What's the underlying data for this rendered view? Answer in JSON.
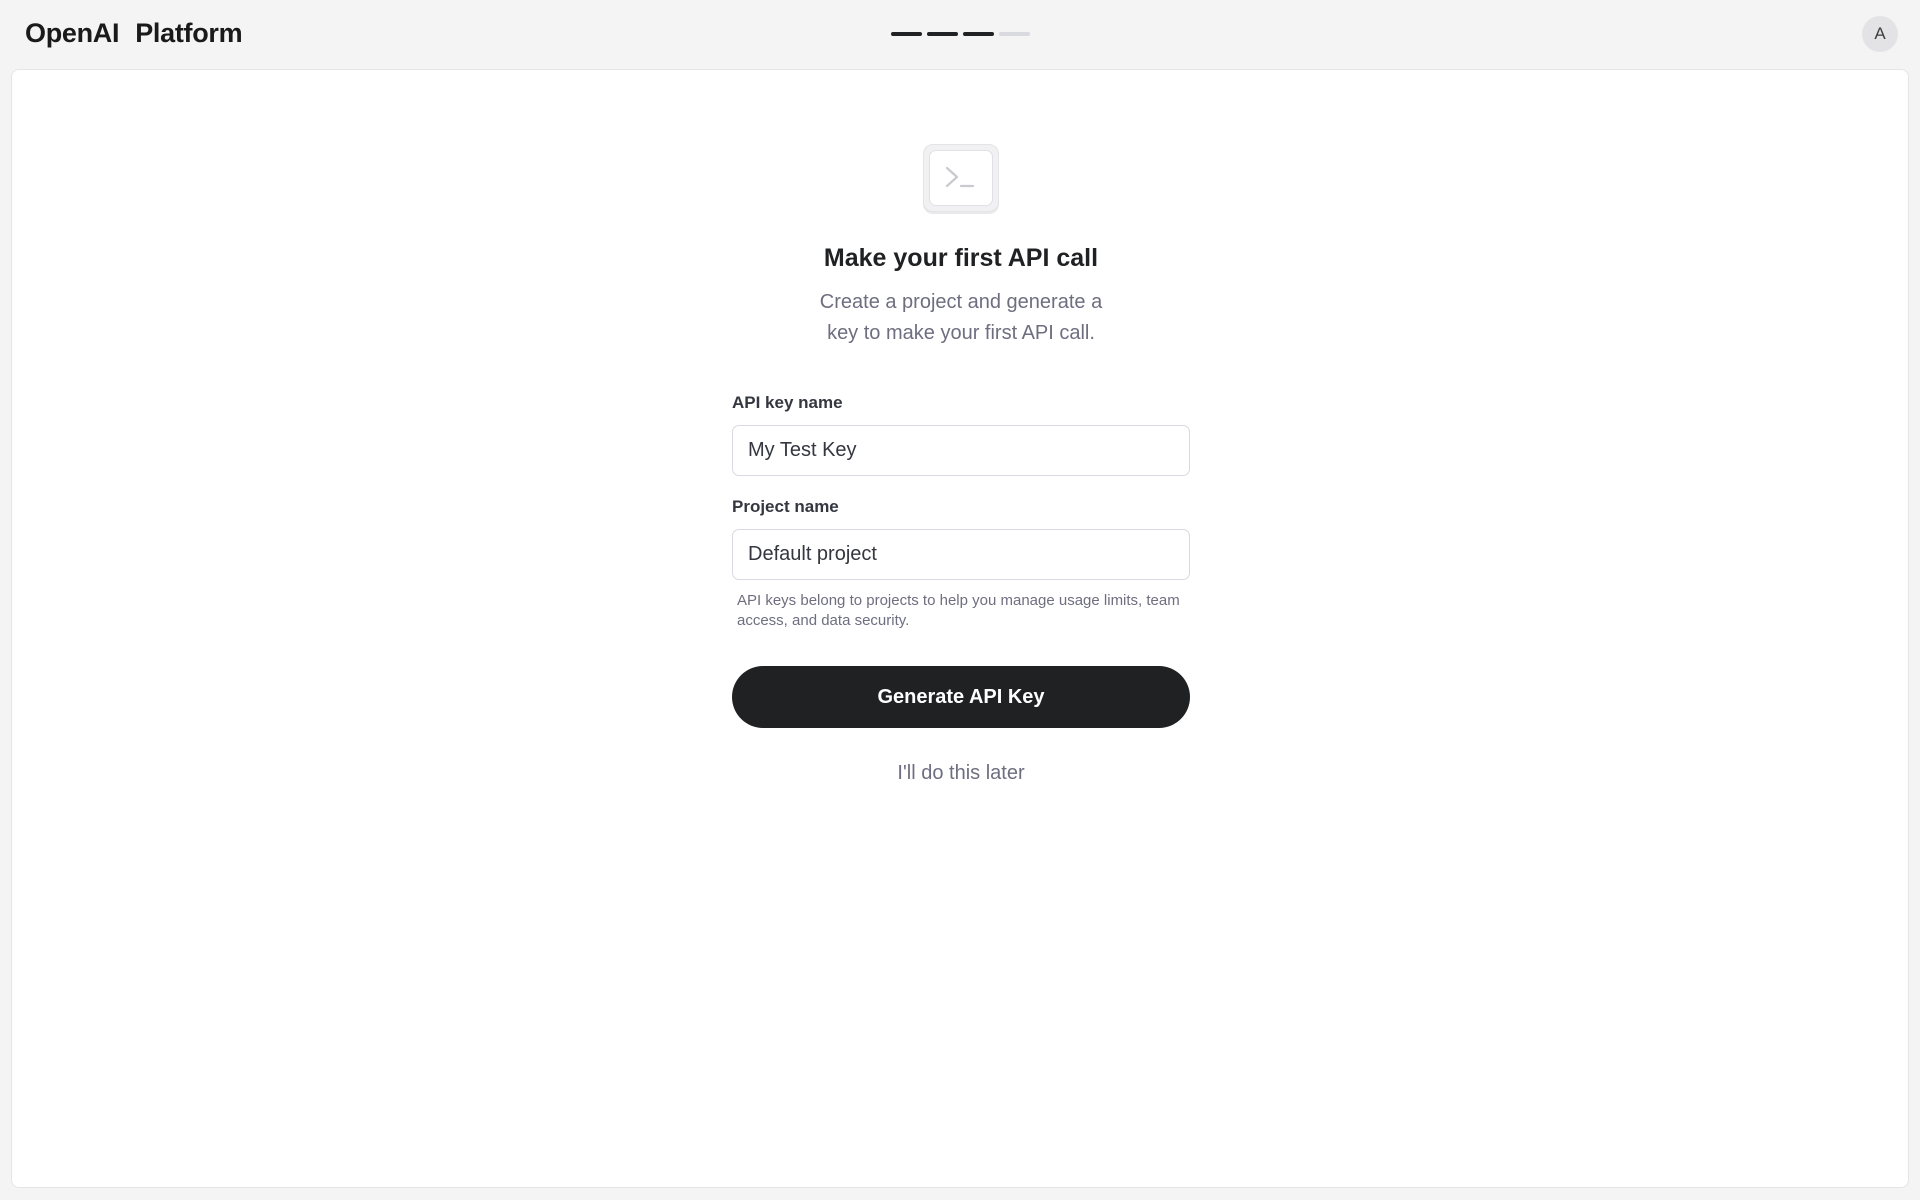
{
  "header": {
    "brand_name": "OpenAI",
    "product_name": "Platform",
    "progress_steps": {
      "total": 4,
      "completed": 3
    },
    "avatar_initial": "A"
  },
  "onboarding": {
    "icon": "terminal-icon",
    "title": "Make your first API call",
    "subtitle": "Create a project and generate a key to make your first API call.",
    "form": {
      "api_key_label": "API key name",
      "api_key_value": "My Test Key",
      "project_label": "Project name",
      "project_value": "Default project",
      "hint": "API keys belong to projects to help you manage usage limits, team access, and data security."
    },
    "generate_button_label": "Generate API Key",
    "skip_link_label": "I'll do this later"
  },
  "colors": {
    "primary": "#202123",
    "muted_text": "#6e6e80",
    "progress_pending": "#d9d9e0",
    "background": "#f4f4f4"
  }
}
